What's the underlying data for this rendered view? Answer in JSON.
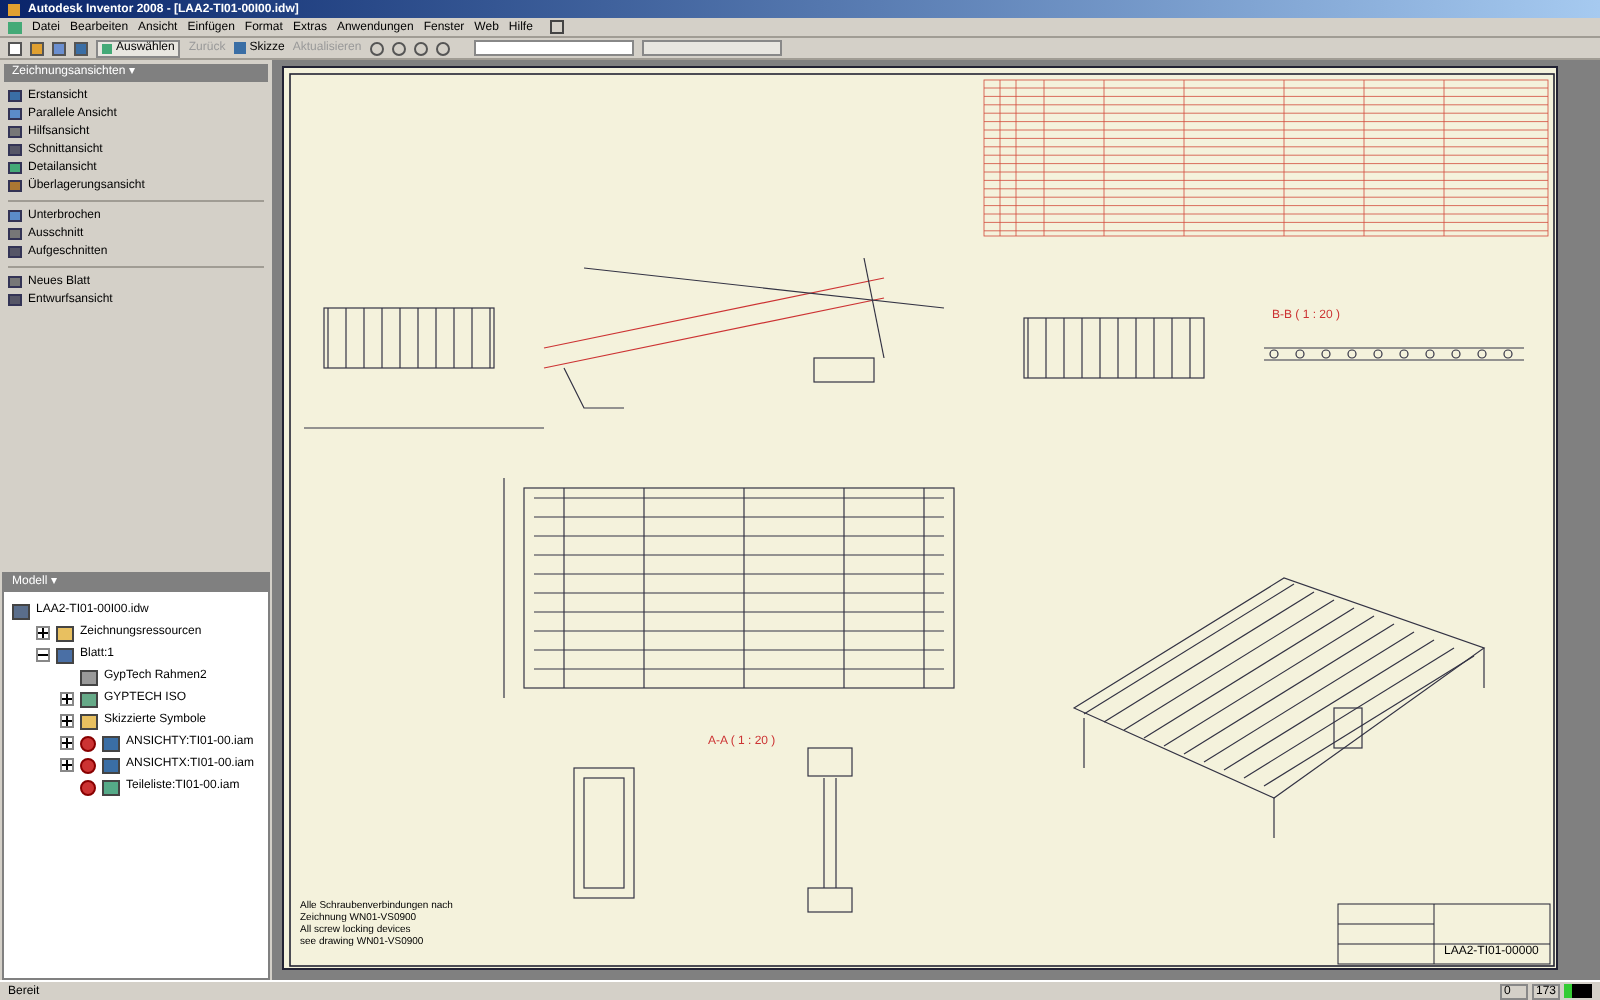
{
  "window": {
    "title": "Autodesk Inventor 2008 - [LAA2-TI01-00I00.idw]"
  },
  "menu": [
    "Datei",
    "Bearbeiten",
    "Ansicht",
    "Einfügen",
    "Format",
    "Extras",
    "Anwendungen",
    "Fenster",
    "Web",
    "Hilfe"
  ],
  "toolbar": {
    "select": "Auswählen",
    "back": "Zurück",
    "sketch": "Skizze",
    "update": "Aktualisieren"
  },
  "views_panel": {
    "title": "Zeichnungsansichten ▾",
    "groups": [
      [
        "Erstansicht",
        "Parallele Ansicht",
        "Hilfsansicht",
        "Schnittansicht",
        "Detailansicht",
        "Überlagerungsansicht"
      ],
      [
        "Unterbrochen",
        "Ausschnitt",
        "Aufgeschnitten"
      ],
      [
        "Neues Blatt",
        "Entwurfsansicht"
      ]
    ]
  },
  "model_panel": {
    "title": "Modell ▾",
    "tree": [
      {
        "label": "LAA2-TI01-00I00.idw",
        "kind": "file",
        "children": [
          {
            "label": "Zeichnungsressourcen",
            "kind": "folder",
            "expanded": false
          },
          {
            "label": "Blatt:1",
            "kind": "sheet",
            "expanded": true,
            "children": [
              {
                "label": "GypTech Rahmen2",
                "kind": "frame"
              },
              {
                "label": "GYPTECH ISO",
                "kind": "block",
                "expanded": false
              },
              {
                "label": "Skizzierte Symbole",
                "kind": "folder",
                "expanded": false
              },
              {
                "label": "ANSICHTY:TI01-00.iam",
                "kind": "view",
                "expanded": false
              },
              {
                "label": "ANSICHTX:TI01-00.iam",
                "kind": "view",
                "expanded": false
              },
              {
                "label": "Teileliste:TI01-00.iam",
                "kind": "list"
              }
            ]
          }
        ]
      }
    ]
  },
  "sheet": {
    "section_bb": "B-B ( 1 : 20 )",
    "section_aa": "A-A ( 1 : 20 )",
    "note": [
      "Alle Schraubenverbindungen nach",
      "Zeichnung WN01-VS0900",
      "All screw locking devices",
      "see drawing WN01-VS0900"
    ],
    "drawing_number": "LAA2-TI01-00000"
  },
  "status_bar": {
    "text": "Bereit",
    "fields": [
      "0",
      "173"
    ]
  }
}
